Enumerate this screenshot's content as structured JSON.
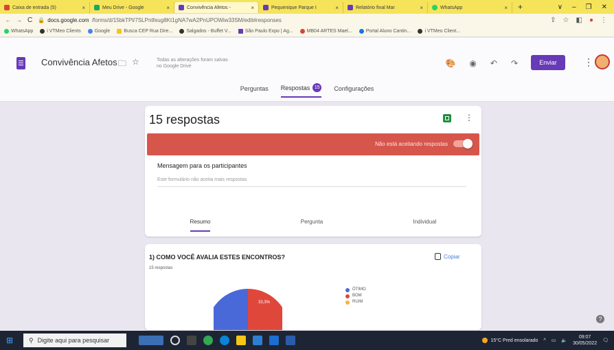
{
  "browser": {
    "tabs": [
      {
        "label": "Caixa de entrada (5)",
        "color": "#d44638"
      },
      {
        "label": "Meu Drive - Google",
        "color": "#1fa463"
      },
      {
        "label": "Convivência Afetos -",
        "color": "#673ab7",
        "active": true
      },
      {
        "label": "Pequenique Parque I",
        "color": "#673ab7"
      },
      {
        "label": "Relatório final Mar",
        "color": "#673ab7"
      },
      {
        "label": "WhatsApp",
        "color": "#25d366"
      }
    ],
    "new_tab": "+",
    "window_buttons": [
      "∨",
      "–",
      "❐",
      "✕"
    ],
    "url_host": "docs.google.com",
    "url_path": "/forms/d/15bkTPl/7SLPntfeug8Kt1gNA7wA2PnUPOWiw33SM/edit#responses",
    "bookmarks": [
      {
        "label": "WhatsApp",
        "color": "#25d366"
      },
      {
        "label": "i VTMeo Clients",
        "color": "#333333"
      },
      {
        "label": "Google",
        "color": "#4285f4"
      },
      {
        "label": "Busca CEP Rua Dire...",
        "color": "#f5c518"
      },
      {
        "label": "Salgados - Buffet V...",
        "color": "#333333"
      },
      {
        "label": "São Paulo Expo | Ag...",
        "color": "#673ab7"
      },
      {
        "label": "MB04 ARTES Mael...",
        "color": "#d44638"
      },
      {
        "label": "Portal Aluno Cantin...",
        "color": "#1a73e8"
      },
      {
        "label": "i VTMeo Client...",
        "color": "#333333"
      }
    ]
  },
  "form": {
    "title": "Convivência Afetos",
    "saved_msg": "Todas as alterações foram salvas no Google Drive",
    "send_label": "Enviar",
    "nav": {
      "questions": "Perguntas",
      "responses": "Respostas",
      "responses_count": "15",
      "settings": "Configurações"
    }
  },
  "responses": {
    "count_title": "15 respostas",
    "closed_text": "Não está aceitando respostas",
    "message_label": "Mensagem para os participantes",
    "message_placeholder": "Este formulário não aceita mais respostas",
    "tabs": {
      "summary": "Resumo",
      "question": "Pergunta",
      "individual": "Individual"
    }
  },
  "question": {
    "title": "1) COMO VOCÊ AVALIA ESTES ENCONTROS?",
    "count": "15 respostas",
    "copy_label": "Copiar",
    "pie_label": "33,3%",
    "legend": [
      {
        "label": "ÓTIMO",
        "color": "#4a69d8"
      },
      {
        "label": "BOM",
        "color": "#e0473b"
      },
      {
        "label": "RUIM",
        "color": "#f5b731"
      }
    ]
  },
  "taskbar": {
    "search_placeholder": "Digite aqui para pesquisar",
    "weather": "15°C Pred ensolarado",
    "time": "09:07",
    "date": "30/05/2022"
  }
}
